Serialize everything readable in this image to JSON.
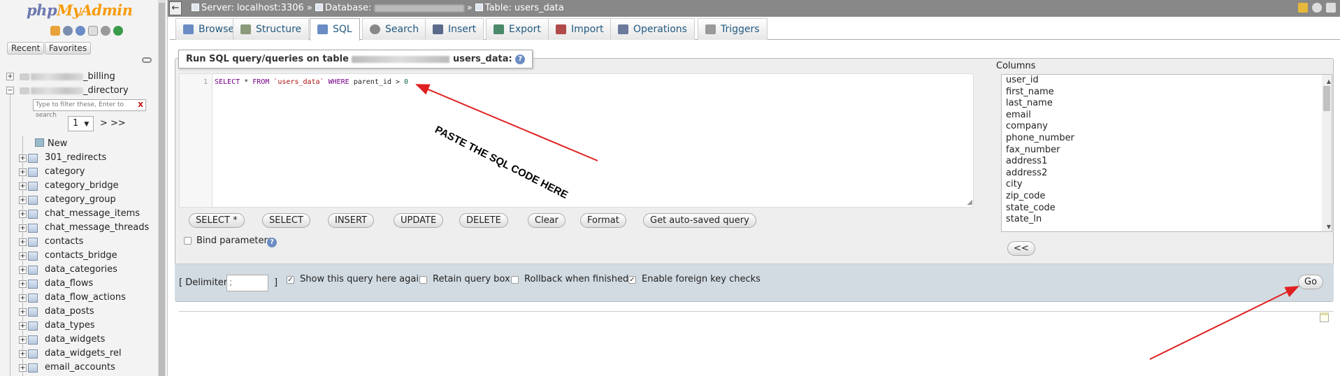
{
  "sidebar": {
    "logo_php": "php",
    "logo_myadmin": "MyAdmin",
    "recent": "Recent",
    "favorites": "Favorites",
    "databases": [
      {
        "suffix": "_billing",
        "toggle": "+"
      },
      {
        "suffix": "_directory",
        "toggle": "−"
      }
    ],
    "filter_placeholder": "Type to filter these, Enter to search",
    "filter_clear": "X",
    "page_value": "1",
    "page_next": "> >>",
    "new_label": "New",
    "tables": [
      "301_redirects",
      "category",
      "category_bridge",
      "category_group",
      "chat_message_items",
      "chat_message_threads",
      "contacts",
      "contacts_bridge",
      "data_categories",
      "data_flows",
      "data_flow_actions",
      "data_posts",
      "data_types",
      "data_widgets",
      "data_widgets_rel",
      "email_accounts"
    ]
  },
  "topbar": {
    "back": "←",
    "server": "Server: localhost:3306",
    "database_label": "Database:",
    "table": "Table: users_data",
    "sep": "»"
  },
  "tabs": [
    {
      "label": "Browse",
      "color": "#6b8cc4"
    },
    {
      "label": "Structure",
      "color": "#8a9a7a"
    },
    {
      "label": "SQL",
      "color": "#6b8cc4"
    },
    {
      "label": "Search",
      "color": "#888"
    },
    {
      "label": "Insert",
      "color": "#5a6a8a"
    },
    {
      "label": "Export",
      "color": "#4a8a6a"
    },
    {
      "label": "Import",
      "color": "#b04a4a"
    },
    {
      "label": "Operations",
      "color": "#6a7a9a"
    },
    {
      "label": "Triggers",
      "color": "#999"
    }
  ],
  "query": {
    "legend_prefix": "Run SQL query/queries on table",
    "legend_suffix": "users_data:",
    "help": "?",
    "line_no": "1",
    "code": {
      "select": "SELECT",
      "star": " * ",
      "from": "FROM",
      "table": "`users_data`",
      "where": "WHERE",
      "cond": " parent_id > ",
      "num": "0"
    },
    "buttons": [
      "SELECT *",
      "SELECT",
      "INSERT",
      "UPDATE",
      "DELETE",
      "Clear",
      "Format",
      "Get auto-saved query"
    ],
    "bind_params": "Bind parameters"
  },
  "columns": {
    "title": "Columns",
    "items": [
      "user_id",
      "first_name",
      "last_name",
      "email",
      "company",
      "phone_number",
      "fax_number",
      "address1",
      "address2",
      "city",
      "zip_code",
      "state_code",
      "state_ln"
    ],
    "insert_btn": "<<"
  },
  "options": {
    "delimiter_label": "[ Delimiter",
    "delimiter_value": ";",
    "delimiter_close": "]",
    "show_again": "Show this query here again",
    "retain": "Retain query box",
    "rollback": "Rollback when finished",
    "foreign_keys": "Enable foreign key checks",
    "go": "Go",
    "check": "✓"
  },
  "annotation": {
    "text": "PASTE THE SQL CODE HERE",
    "color": "#e02020"
  }
}
